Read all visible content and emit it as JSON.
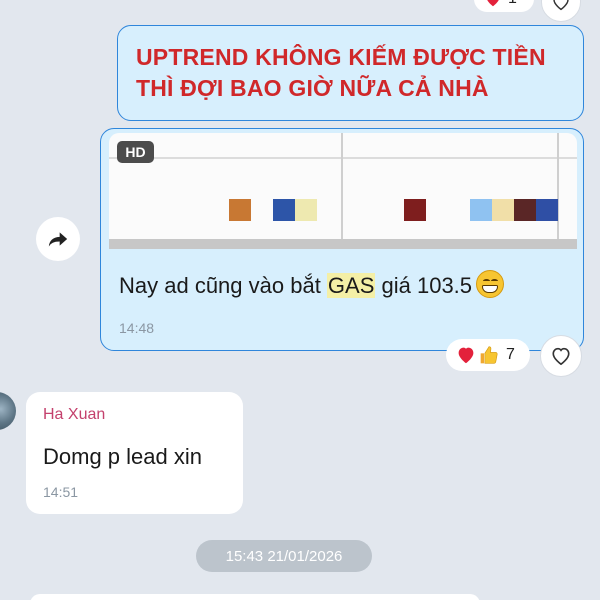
{
  "top_reaction": {
    "count": "1"
  },
  "messages": {
    "uptrend": {
      "text": "UPTREND KHÔNG KIẾM ĐƯỢC TIỀN THÌ ĐỢI BAO GIỜ NỮA CẢ NHÀ"
    },
    "gas": {
      "badge": "HD",
      "text_before": "Nay ad cũng vào bắt ",
      "highlight": "GAS",
      "text_after": " giá 103.5",
      "time": "14:48"
    },
    "reply": {
      "sender": "Ha Xuan",
      "text": "Domg p lead xin",
      "time": "14:51"
    }
  },
  "reactions": {
    "count": "7"
  },
  "date_separator": "15:43 21/01/2026",
  "colors": {
    "background": "#e2e7ee",
    "outgoing_bubble": "#d7effd",
    "outgoing_border": "#2f86db",
    "headline_red": "#d0282a",
    "sender_pink": "#c4416d",
    "timestamp": "#8b97a3",
    "highlight": "#f4efa6"
  },
  "icons": {
    "forward": "forward-arrow-icon",
    "react": "heart-outline-icon",
    "reaction_heart": "red-heart-icon",
    "reaction_thumb": "thumbs-up-icon",
    "emoji": "grinning-emoji-icon"
  }
}
